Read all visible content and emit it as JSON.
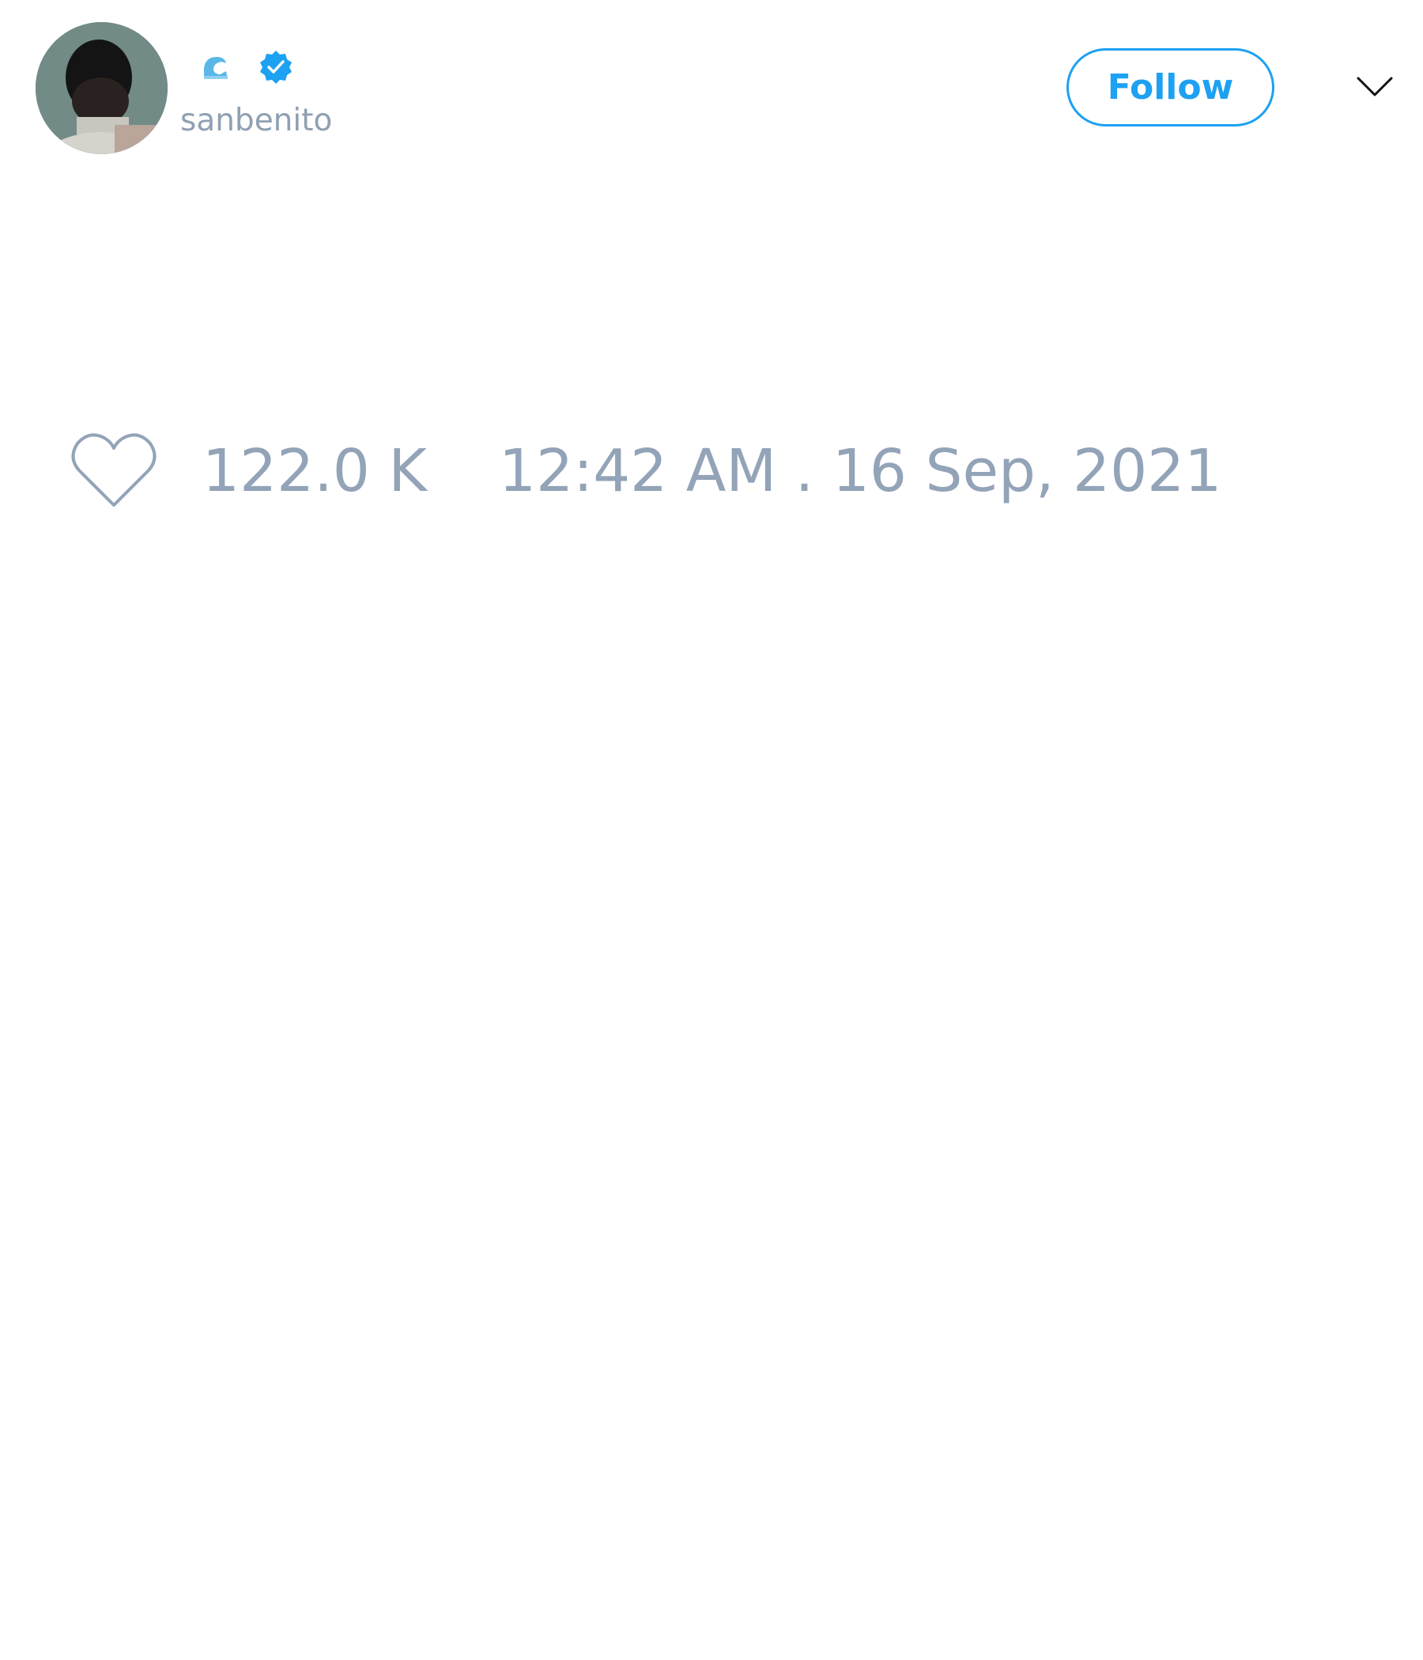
{
  "author": {
    "name_icon": "water-wave-icon",
    "verified_icon": "verified-badge-icon",
    "handle": "sanbenito"
  },
  "actions": {
    "follow_label": "Follow",
    "menu_icon": "chevron-down-icon"
  },
  "tweet": {
    "like_icon": "heart-icon",
    "likes": "122.0 K",
    "timestamp": "12:42 AM . 16 Sep, 2021"
  },
  "colors": {
    "accent": "#1da1f2",
    "muted_text": "#93a3b8",
    "background": "#ffffff"
  }
}
